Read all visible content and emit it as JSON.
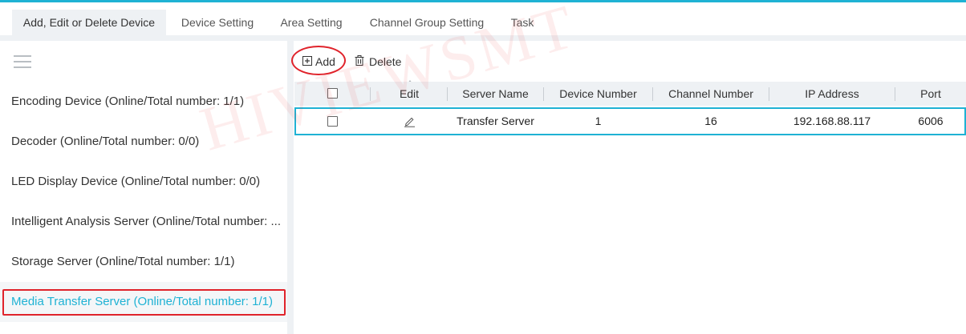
{
  "tabs": [
    {
      "label": "Add, Edit or Delete Device",
      "active": true
    },
    {
      "label": "Device Setting",
      "active": false
    },
    {
      "label": "Area Setting",
      "active": false
    },
    {
      "label": "Channel Group Setting",
      "active": false
    },
    {
      "label": "Task",
      "active": false
    }
  ],
  "sidebar": {
    "menu_icon": "hamburger-icon",
    "items": [
      {
        "label": "Encoding Device (Online/Total number: 1/1)"
      },
      {
        "label": "Decoder (Online/Total number: 0/0)"
      },
      {
        "label": "LED Display Device (Online/Total number: 0/0)"
      },
      {
        "label": "Intelligent Analysis Server (Online/Total number: ..."
      },
      {
        "label": "Storage Server (Online/Total number: 1/1)"
      },
      {
        "label": "Media Transfer Server (Online/Total number: 1/1)",
        "selected": true
      }
    ]
  },
  "toolbar": {
    "add_label": "Add",
    "add_icon": "plus-square-icon",
    "delete_label": "Delete",
    "delete_icon": "trash-icon"
  },
  "table": {
    "columns": [
      "Edit",
      "Server Name",
      "Device Number",
      "Channel Number",
      "IP Address",
      "Port"
    ],
    "rows": [
      {
        "edit_icon": "pencil-icon",
        "server_name": "Transfer Server",
        "device_number": "1",
        "channel_number": "16",
        "ip_address": "192.168.88.117",
        "port": "6006"
      }
    ]
  },
  "watermark": "HIVIEWSMT",
  "colors": {
    "accent": "#1fb2d4",
    "annotation_red": "#e0232b",
    "panel_bg": "#eef1f4"
  }
}
